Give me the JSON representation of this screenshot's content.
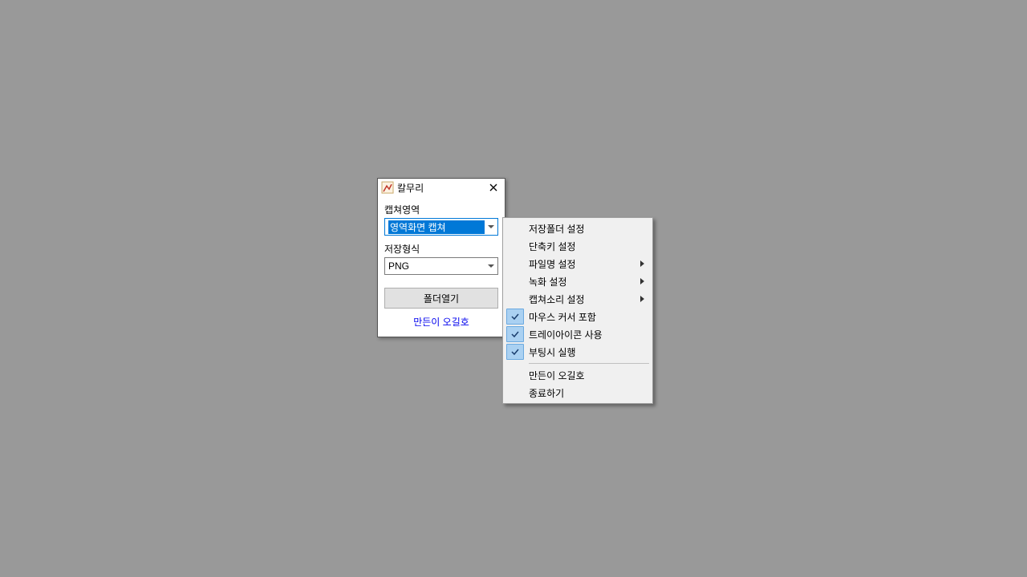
{
  "window": {
    "title": "칼무리",
    "captureAreaLabel": "캡쳐영역",
    "captureAreaValue": "영역화면 캡쳐",
    "saveFormatLabel": "저장형식",
    "saveFormatValue": "PNG",
    "openFolderButton": "폴더열기",
    "authorLink": "만든이 오길호"
  },
  "menu": {
    "items": [
      {
        "label": "저장폴더 설정",
        "checked": false,
        "submenu": false
      },
      {
        "label": "단축키 설정",
        "checked": false,
        "submenu": false
      },
      {
        "label": "파일명 설정",
        "checked": false,
        "submenu": true
      },
      {
        "label": "녹화 설정",
        "checked": false,
        "submenu": true
      },
      {
        "label": "캡쳐소리 설정",
        "checked": false,
        "submenu": true
      },
      {
        "label": "마우스 커서 포함",
        "checked": true,
        "submenu": false
      },
      {
        "label": "트레이아이콘 사용",
        "checked": true,
        "submenu": false
      },
      {
        "label": "부팅시 실행",
        "checked": true,
        "submenu": false
      }
    ],
    "sepAfterIndex": 7,
    "footerItems": [
      {
        "label": "만든이 오길호"
      },
      {
        "label": "종료하기"
      }
    ]
  }
}
